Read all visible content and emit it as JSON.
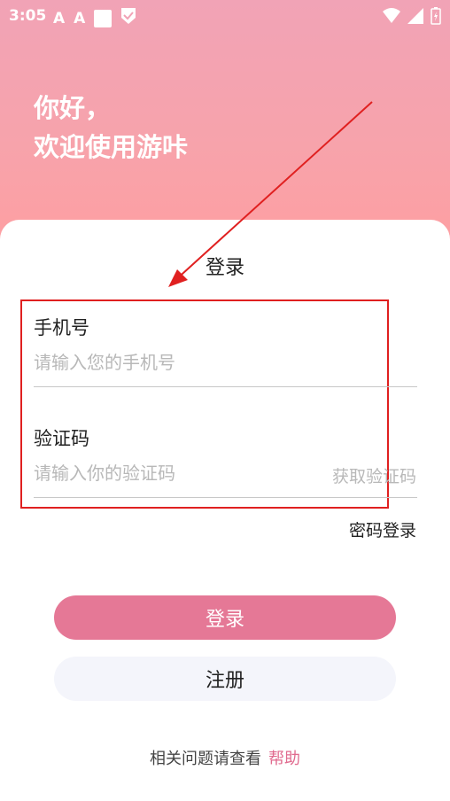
{
  "status_bar": {
    "time": "3:05"
  },
  "header": {
    "greeting_line1": "你好，",
    "greeting_line2": "欢迎使用游咔"
  },
  "login_form": {
    "title": "登录",
    "phone_label": "手机号",
    "phone_placeholder": "请输入您的手机号",
    "code_label": "验证码",
    "code_placeholder": "请输入你的验证码",
    "get_code_label": "获取验证码",
    "password_login_label": "密码登录"
  },
  "buttons": {
    "login": "登录",
    "register": "注册"
  },
  "footer": {
    "help_text": "相关问题请查看",
    "help_link": "帮助"
  },
  "colors": {
    "accent": "#e57896",
    "annotation": "#e02020"
  }
}
